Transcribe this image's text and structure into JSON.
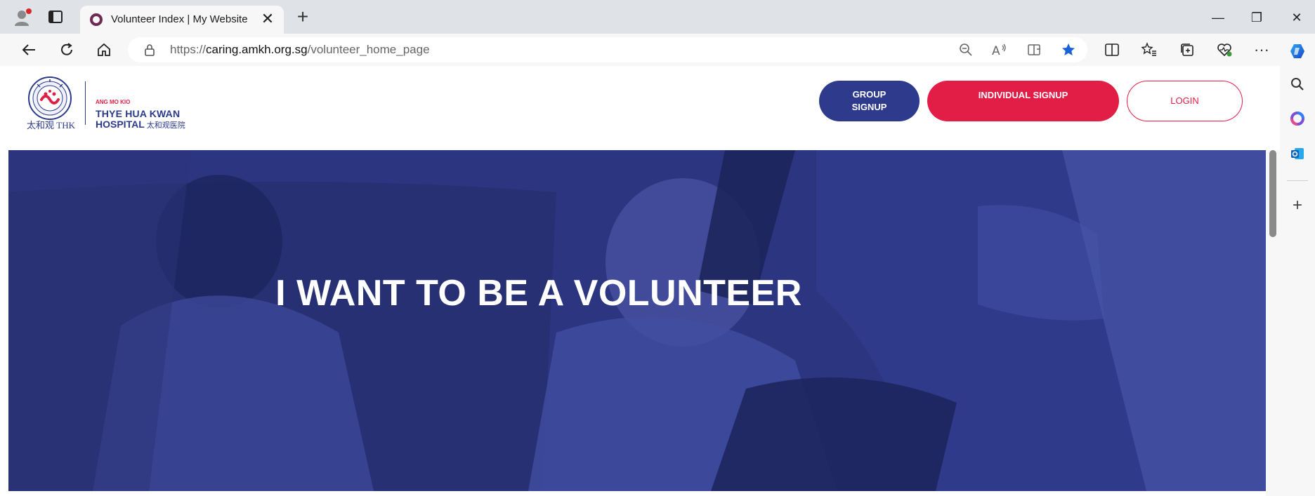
{
  "browser": {
    "tab_title": "Volunteer Index | My Website",
    "tab_close": "✕",
    "new_tab": "+",
    "url_host": "caring.amkh.org.sg",
    "url_prefix": "https://",
    "url_path": "/volunteer_home_page",
    "window_minimize": "—",
    "window_restore": "❐",
    "window_close": "✕",
    "more_menu": "···",
    "sidebar_add": "+"
  },
  "site": {
    "logo": {
      "thk_text": "太和观 THK",
      "amk_text": "ANG MO KIO",
      "line1": "THYE HUA KWAN",
      "line2": "HOSPITAL",
      "line2_cn": "太和观医院"
    },
    "nav": {
      "group_signup_line1": "GROUP",
      "group_signup_line2": "SIGNUP",
      "individual_signup": "INDIVIDUAL SIGNUP",
      "login": "LOGIN"
    },
    "hero": {
      "title": "I WANT TO BE A VOLUNTEER"
    }
  },
  "colors": {
    "brand_navy": "#2e3a8c",
    "brand_red": "#e21d46",
    "hero_overlay": "#2c3580"
  }
}
